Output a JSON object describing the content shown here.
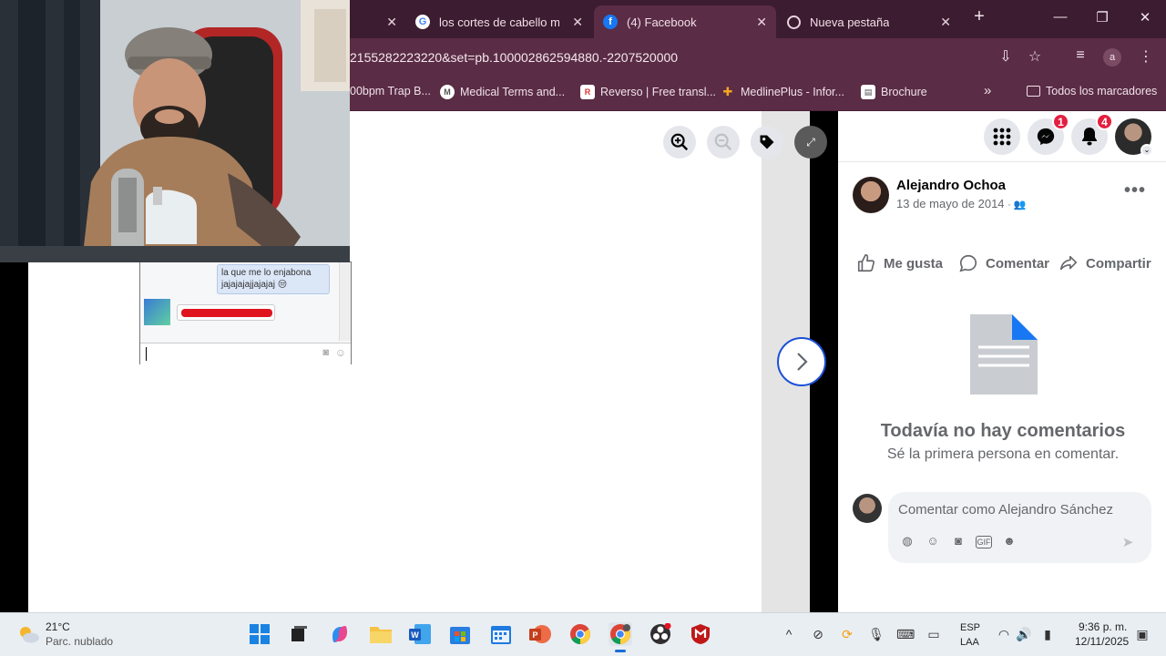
{
  "browser": {
    "tabs": [
      {
        "title": "",
        "active": false
      },
      {
        "title": "los cortes de cabello mas",
        "active": false
      },
      {
        "title": "(4) Facebook",
        "active": true
      },
      {
        "title": "Nueva pestaña",
        "active": false
      }
    ],
    "new_tab_glyph": "+",
    "url": "2155282223220&set=pb.100002862594880.-2207520000",
    "profile_initial": "a",
    "bookmarks": [
      {
        "label": "00bpm Trap B...",
        "icon": "music-icon"
      },
      {
        "label": "Medical Terms and...",
        "icon": "site-icon"
      },
      {
        "label": "Reverso | Free transl...",
        "icon": "reverso-icon"
      },
      {
        "label": "MedlinePlus - Infor...",
        "icon": "medlineplus-icon"
      },
      {
        "label": "Brochure",
        "icon": "doc-icon"
      }
    ],
    "all_bookmarks": "Todos los marcadores",
    "overflow_glyph": "»"
  },
  "photo_content": {
    "chat_bubble_text": "la que me lo enjabona jajajajajjajajaj 😒"
  },
  "facebook": {
    "messenger_badge": "1",
    "notifications_badge": "4",
    "post": {
      "author": "Alejandro Ochoa",
      "date": "13 de mayo de 2014",
      "audience_icon": "friends-icon",
      "more": "•••"
    },
    "actions": {
      "like": "Me gusta",
      "comment": "Comentar",
      "share": "Compartir"
    },
    "empty_state": {
      "title": "Todavía no hay comentarios",
      "subtitle": "Sé la primera persona en comentar."
    },
    "comment_placeholder": "Comentar como Alejandro Sánchez"
  },
  "taskbar": {
    "weather_temp": "21°C",
    "weather_desc": "Parc. nublado",
    "language_line1": "ESP",
    "language_line2": "LAA",
    "time": "9:36 p. m.",
    "date": "12/11/2025",
    "tray_up_glyph": "^"
  },
  "colors": {
    "chrome_tabbar": "#3c1c30",
    "chrome_toolbar": "#5a2c45",
    "fb_blue": "#1b4fd8",
    "badge_red": "#e41e3f"
  }
}
